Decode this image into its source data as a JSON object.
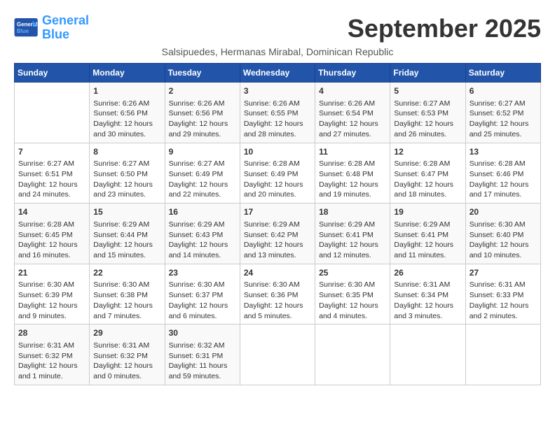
{
  "logo": {
    "line1": "General",
    "line2": "Blue"
  },
  "title": "September 2025",
  "subtitle": "Salsipuedes, Hermanas Mirabal, Dominican Republic",
  "days_header": [
    "Sunday",
    "Monday",
    "Tuesday",
    "Wednesday",
    "Thursday",
    "Friday",
    "Saturday"
  ],
  "weeks": [
    [
      {
        "num": "",
        "info": ""
      },
      {
        "num": "1",
        "info": "Sunrise: 6:26 AM\nSunset: 6:56 PM\nDaylight: 12 hours\nand 30 minutes."
      },
      {
        "num": "2",
        "info": "Sunrise: 6:26 AM\nSunset: 6:56 PM\nDaylight: 12 hours\nand 29 minutes."
      },
      {
        "num": "3",
        "info": "Sunrise: 6:26 AM\nSunset: 6:55 PM\nDaylight: 12 hours\nand 28 minutes."
      },
      {
        "num": "4",
        "info": "Sunrise: 6:26 AM\nSunset: 6:54 PM\nDaylight: 12 hours\nand 27 minutes."
      },
      {
        "num": "5",
        "info": "Sunrise: 6:27 AM\nSunset: 6:53 PM\nDaylight: 12 hours\nand 26 minutes."
      },
      {
        "num": "6",
        "info": "Sunrise: 6:27 AM\nSunset: 6:52 PM\nDaylight: 12 hours\nand 25 minutes."
      }
    ],
    [
      {
        "num": "7",
        "info": "Sunrise: 6:27 AM\nSunset: 6:51 PM\nDaylight: 12 hours\nand 24 minutes."
      },
      {
        "num": "8",
        "info": "Sunrise: 6:27 AM\nSunset: 6:50 PM\nDaylight: 12 hours\nand 23 minutes."
      },
      {
        "num": "9",
        "info": "Sunrise: 6:27 AM\nSunset: 6:49 PM\nDaylight: 12 hours\nand 22 minutes."
      },
      {
        "num": "10",
        "info": "Sunrise: 6:28 AM\nSunset: 6:49 PM\nDaylight: 12 hours\nand 20 minutes."
      },
      {
        "num": "11",
        "info": "Sunrise: 6:28 AM\nSunset: 6:48 PM\nDaylight: 12 hours\nand 19 minutes."
      },
      {
        "num": "12",
        "info": "Sunrise: 6:28 AM\nSunset: 6:47 PM\nDaylight: 12 hours\nand 18 minutes."
      },
      {
        "num": "13",
        "info": "Sunrise: 6:28 AM\nSunset: 6:46 PM\nDaylight: 12 hours\nand 17 minutes."
      }
    ],
    [
      {
        "num": "14",
        "info": "Sunrise: 6:28 AM\nSunset: 6:45 PM\nDaylight: 12 hours\nand 16 minutes."
      },
      {
        "num": "15",
        "info": "Sunrise: 6:29 AM\nSunset: 6:44 PM\nDaylight: 12 hours\nand 15 minutes."
      },
      {
        "num": "16",
        "info": "Sunrise: 6:29 AM\nSunset: 6:43 PM\nDaylight: 12 hours\nand 14 minutes."
      },
      {
        "num": "17",
        "info": "Sunrise: 6:29 AM\nSunset: 6:42 PM\nDaylight: 12 hours\nand 13 minutes."
      },
      {
        "num": "18",
        "info": "Sunrise: 6:29 AM\nSunset: 6:41 PM\nDaylight: 12 hours\nand 12 minutes."
      },
      {
        "num": "19",
        "info": "Sunrise: 6:29 AM\nSunset: 6:41 PM\nDaylight: 12 hours\nand 11 minutes."
      },
      {
        "num": "20",
        "info": "Sunrise: 6:30 AM\nSunset: 6:40 PM\nDaylight: 12 hours\nand 10 minutes."
      }
    ],
    [
      {
        "num": "21",
        "info": "Sunrise: 6:30 AM\nSunset: 6:39 PM\nDaylight: 12 hours\nand 9 minutes."
      },
      {
        "num": "22",
        "info": "Sunrise: 6:30 AM\nSunset: 6:38 PM\nDaylight: 12 hours\nand 7 minutes."
      },
      {
        "num": "23",
        "info": "Sunrise: 6:30 AM\nSunset: 6:37 PM\nDaylight: 12 hours\nand 6 minutes."
      },
      {
        "num": "24",
        "info": "Sunrise: 6:30 AM\nSunset: 6:36 PM\nDaylight: 12 hours\nand 5 minutes."
      },
      {
        "num": "25",
        "info": "Sunrise: 6:30 AM\nSunset: 6:35 PM\nDaylight: 12 hours\nand 4 minutes."
      },
      {
        "num": "26",
        "info": "Sunrise: 6:31 AM\nSunset: 6:34 PM\nDaylight: 12 hours\nand 3 minutes."
      },
      {
        "num": "27",
        "info": "Sunrise: 6:31 AM\nSunset: 6:33 PM\nDaylight: 12 hours\nand 2 minutes."
      }
    ],
    [
      {
        "num": "28",
        "info": "Sunrise: 6:31 AM\nSunset: 6:32 PM\nDaylight: 12 hours\nand 1 minute."
      },
      {
        "num": "29",
        "info": "Sunrise: 6:31 AM\nSunset: 6:32 PM\nDaylight: 12 hours\nand 0 minutes."
      },
      {
        "num": "30",
        "info": "Sunrise: 6:32 AM\nSunset: 6:31 PM\nDaylight: 11 hours\nand 59 minutes."
      },
      {
        "num": "",
        "info": ""
      },
      {
        "num": "",
        "info": ""
      },
      {
        "num": "",
        "info": ""
      },
      {
        "num": "",
        "info": ""
      }
    ]
  ]
}
